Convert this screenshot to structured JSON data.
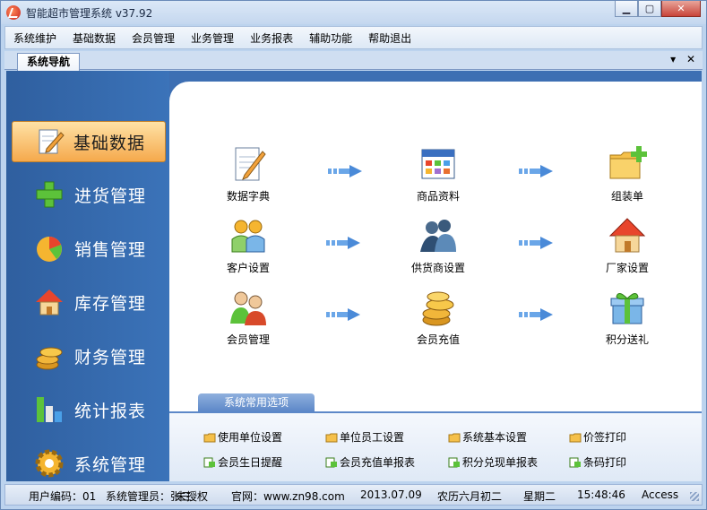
{
  "window": {
    "title": "智能超市管理系统 v37.92"
  },
  "menu": [
    "系统维护",
    "基础数据",
    "会员管理",
    "业务管理",
    "业务报表",
    "辅助功能",
    "帮助退出"
  ],
  "tab": {
    "label": "系统导航"
  },
  "sidebar": [
    {
      "label": "基础数据",
      "icon": "pencil-paper-icon",
      "active": true
    },
    {
      "label": "进货管理",
      "icon": "green-plus-icon"
    },
    {
      "label": "销售管理",
      "icon": "pie-chart-icon"
    },
    {
      "label": "库存管理",
      "icon": "house-icon"
    },
    {
      "label": "财务管理",
      "icon": "coins-icon"
    },
    {
      "label": "统计报表",
      "icon": "bar-chart-icon"
    },
    {
      "label": "系统管理",
      "icon": "gear-icon"
    }
  ],
  "tiles": [
    {
      "label": "数据字典",
      "icon": "pencil-paper-icon"
    },
    {
      "label": "商品资料",
      "icon": "calendar-grid-icon"
    },
    {
      "label": "组装单",
      "icon": "folder-plus-icon"
    },
    {
      "label": "客户设置",
      "icon": "customers-icon"
    },
    {
      "label": "供货商设置",
      "icon": "suppliers-icon"
    },
    {
      "label": "厂家设置",
      "icon": "house-icon"
    },
    {
      "label": "会员管理",
      "icon": "members-icon"
    },
    {
      "label": "会员充值",
      "icon": "coins-icon"
    },
    {
      "label": "积分送礼",
      "icon": "gift-icon"
    }
  ],
  "options": {
    "title": "系统常用选项",
    "items": [
      "使用单位设置",
      "单位员工设置",
      "系统基本设置",
      "价签打印",
      "会员生日提醒",
      "会员充值单报表",
      "积分兑现单报表",
      "条码打印"
    ]
  },
  "status": {
    "user_code": "用户编码：01",
    "user_name": "系统管理员：张三",
    "license": "未授权",
    "website": "官网：www.zn98.com",
    "date": "2013.07.09",
    "lunar": "农历六月初二",
    "weekday": "星期二",
    "time": "15:48:46",
    "db": "Access"
  },
  "colors": {
    "accent": "#3d6fb3",
    "active_nav": "#f5a94c"
  }
}
